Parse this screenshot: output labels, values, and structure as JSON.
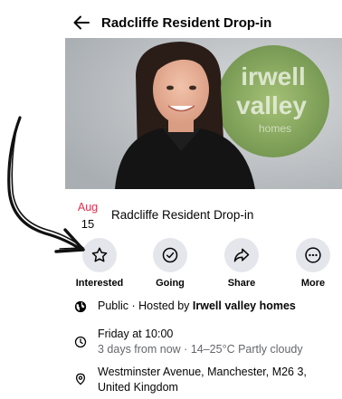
{
  "header": {
    "title": "Radcliffe Resident Drop-in"
  },
  "cover": {
    "logo_line1": "irwell",
    "logo_line2": "valley",
    "logo_line3": "homes"
  },
  "event": {
    "month": "Aug",
    "day": "15",
    "title": "Radcliffe Resident Drop-in"
  },
  "actions": [
    {
      "label": "Interested",
      "icon": "star-icon"
    },
    {
      "label": "Going",
      "icon": "check-circle-icon"
    },
    {
      "label": "Share",
      "icon": "share-arrow-icon"
    },
    {
      "label": "More",
      "icon": "more-dots-icon"
    }
  ],
  "details": {
    "privacy": "Public · Hosted by ",
    "host": "Irwell valley homes",
    "time": "Friday at 10:00",
    "time_sub": "3 days from now · 14–25°C Partly cloudy",
    "address_line1": "Westminster Avenue, Manchester, M26 3,",
    "address_line2": "United Kingdom"
  },
  "colors": {
    "accent_date": "#e0314e",
    "button_bg": "#e4e6eb",
    "secondary_text": "#65676b"
  }
}
